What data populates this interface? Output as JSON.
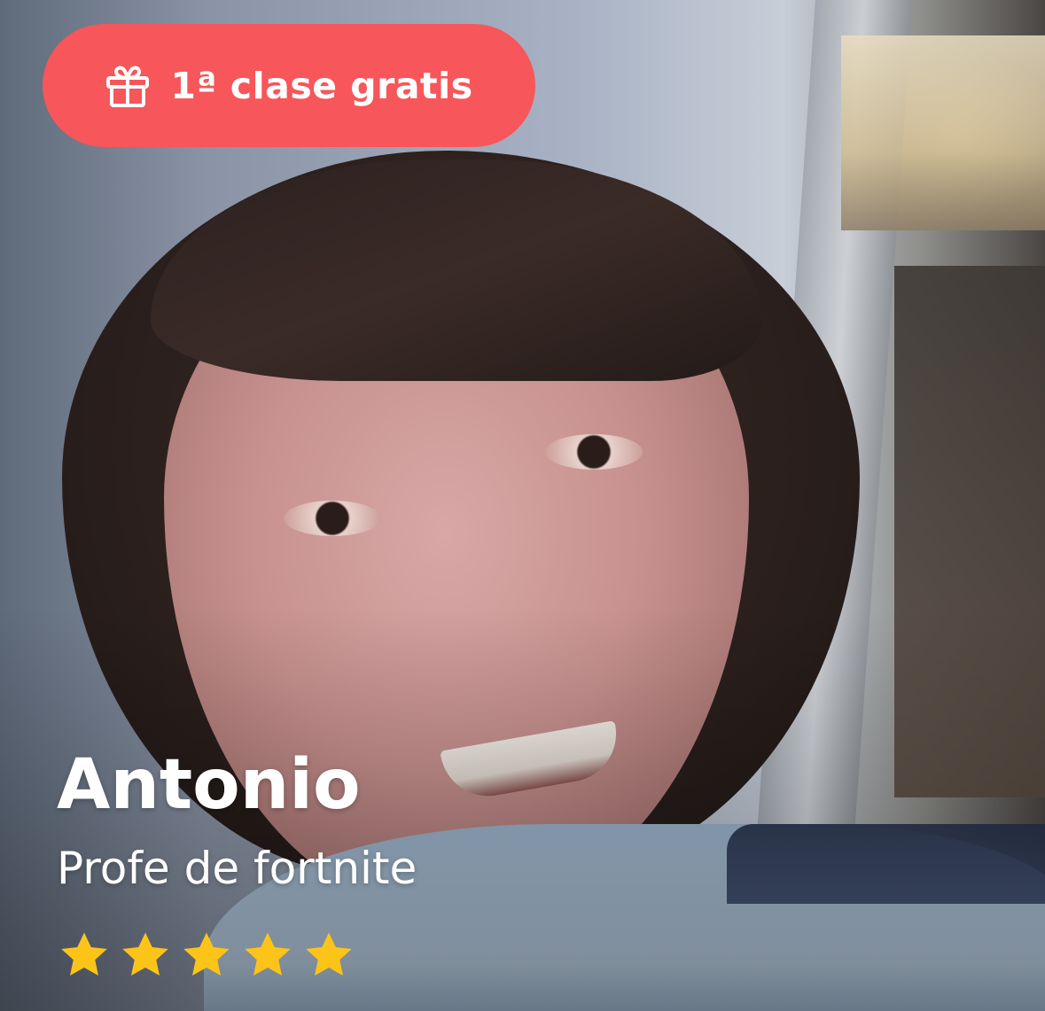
{
  "promo": {
    "icon": "gift-icon",
    "label": "1ª clase gratis",
    "color": "#f7565a"
  },
  "teacher": {
    "name": "Antonio",
    "subtitle": "Profe de fortnite",
    "rating": 5,
    "rating_max": 5,
    "star_color": "#fcc419"
  }
}
